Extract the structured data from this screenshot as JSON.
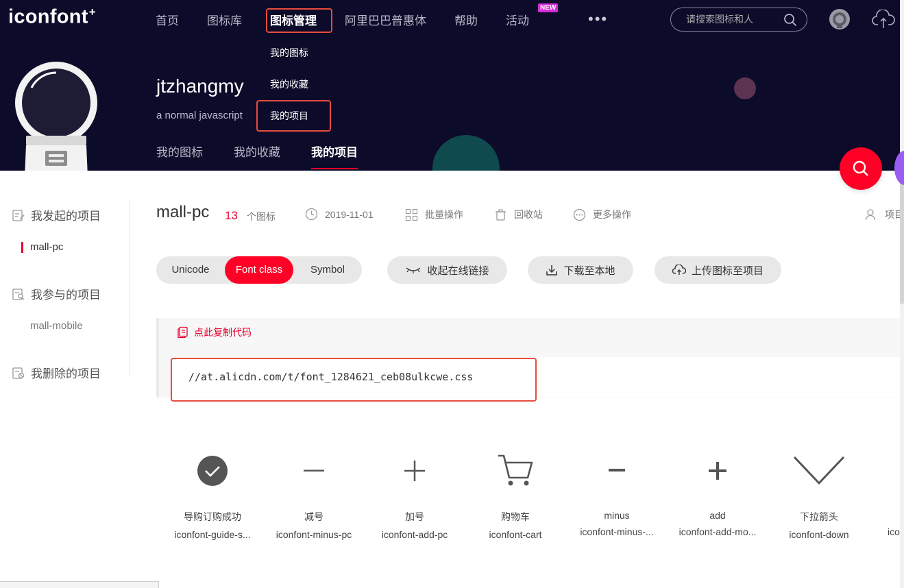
{
  "header": {
    "logo": "iconfont",
    "logo_plus": "+",
    "nav": [
      "首页",
      "图标库",
      "图标管理",
      "阿里巴巴普惠体",
      "帮助",
      "活动"
    ],
    "new_badge": "NEW",
    "more": "•••",
    "search_placeholder": "请搜索图标和人"
  },
  "dropdown": [
    "我的图标",
    "我的收藏",
    "我的项目"
  ],
  "profile": {
    "username": "jtzhangmy",
    "bio": "a normal javascript",
    "tabs": [
      "我的图标",
      "我的收藏",
      "我的项目"
    ]
  },
  "sidebar": {
    "group_started": "我发起的项目",
    "started_projects": [
      "mall-pc"
    ],
    "group_joined": "我参与的项目",
    "joined_projects": [
      "mall-mobile"
    ],
    "group_deleted": "我删除的项目"
  },
  "project": {
    "name": "mall-pc",
    "icon_count": "13",
    "icon_count_label": "个图标",
    "date": "2019-11-01",
    "batch": "批量操作",
    "recycle": "回收站",
    "more_ops": "更多操作",
    "settings": "项目"
  },
  "formats": {
    "options": [
      "Unicode",
      "Font class",
      "Symbol"
    ],
    "selected": "Font class"
  },
  "actions": {
    "collapse_link": "收起在线链接",
    "download": "下载至本地",
    "upload": "上传图标至项目"
  },
  "code": {
    "copy_label": "点此复制代码",
    "url": "//at.alicdn.com/t/font_1284621_ceb08ulkcwe.css"
  },
  "icons": [
    {
      "name": "导购订购成功",
      "class": "iconfont-guide-s...",
      "glyph": "check-circle-icon"
    },
    {
      "name": "减号",
      "class": "iconfont-minus-pc",
      "glyph": "minus-icon"
    },
    {
      "name": "加号",
      "class": "iconfont-add-pc",
      "glyph": "plus-icon"
    },
    {
      "name": "购物车",
      "class": "iconfont-cart",
      "glyph": "cart-icon"
    },
    {
      "name": "minus",
      "class": "iconfont-minus-...",
      "glyph": "minus-bold-icon"
    },
    {
      "name": "add",
      "class": "iconfont-add-mo...",
      "glyph": "plus-bold-icon"
    },
    {
      "name": "下拉箭头",
      "class": "iconfont-down",
      "glyph": "chevron-down-icon"
    },
    {
      "name": "",
      "class": "ico",
      "glyph": ""
    }
  ],
  "colors": {
    "brand_red": "#ff0027",
    "header_bg": "#0c0b2a",
    "highlight": "#e74c3c",
    "new_badge": "#d52bd8"
  }
}
